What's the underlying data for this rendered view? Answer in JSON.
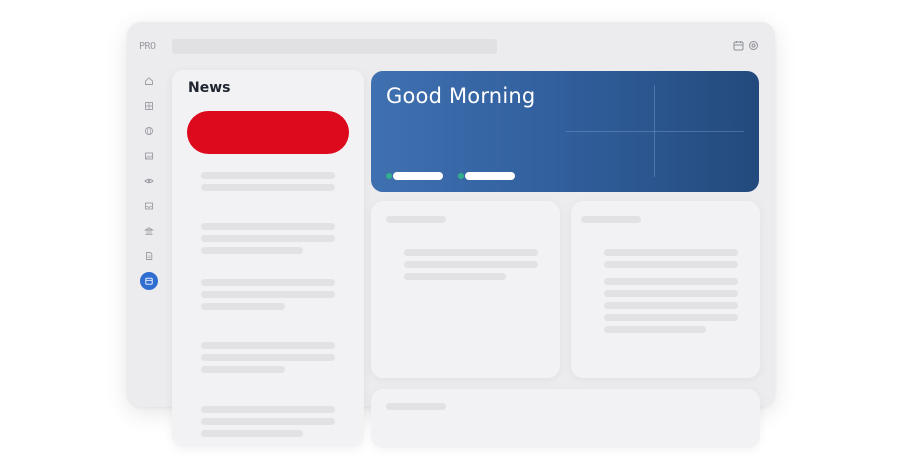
{
  "app": {
    "logo_text": "PRO"
  },
  "colors": {
    "accent": "#2f6dd0",
    "news_highlight": "#dc0a1c",
    "hero_start": "#3f70b0",
    "hero_end": "#234a7c",
    "hero_dot": "#2fb08a"
  },
  "top_icons": [
    "calendar-icon",
    "settings-icon"
  ],
  "sidebar": {
    "items": [
      {
        "icon": "home-icon",
        "active": false
      },
      {
        "icon": "grid-icon",
        "active": false
      },
      {
        "icon": "globe-icon",
        "active": false
      },
      {
        "icon": "image-icon",
        "active": false
      },
      {
        "icon": "view-icon",
        "active": false
      },
      {
        "icon": "inbox-icon",
        "active": false
      },
      {
        "icon": "bank-icon",
        "active": false
      },
      {
        "icon": "document-icon",
        "active": false
      },
      {
        "icon": "calendar-icon",
        "active": true
      }
    ]
  },
  "news": {
    "title": "News"
  },
  "hero": {
    "title": "Good Morning"
  }
}
